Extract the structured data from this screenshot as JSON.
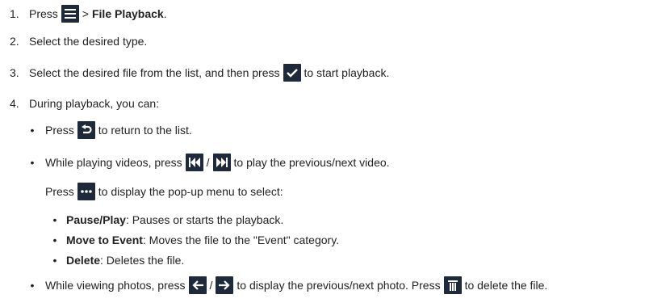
{
  "steps": {
    "s1": {
      "num": "1.",
      "pre": "Press",
      "gt": ">",
      "bold": "File Playback",
      "post": "."
    },
    "s2": {
      "num": "2.",
      "text": "Select the desired type."
    },
    "s3": {
      "num": "3.",
      "pre": "Select the desired file from the list, and then press",
      "post": "to start playback."
    },
    "s4": {
      "num": "4.",
      "text": "During playback, you can:"
    }
  },
  "bullets": {
    "b1": {
      "pre": "Press",
      "post": "to return to the list."
    },
    "b2": {
      "pre": "While playing videos, press",
      "sep": "/",
      "post": "to play the previous/next video."
    },
    "popup": {
      "pre": "Press",
      "post": "to display the pop-up menu to select:"
    },
    "sub": [
      {
        "bold": "Pause/Play",
        "text": ": Pauses or starts the playback."
      },
      {
        "bold": "Move to Event",
        "text": ": Moves the file to the \"Event\" category."
      },
      {
        "bold": "Delete",
        "text": ": Deletes the file."
      }
    ],
    "b3": {
      "pre": "While viewing photos, press",
      "sep": "/",
      "mid": "to display the previous/next photo. Press",
      "post": "to delete the file."
    }
  },
  "bullet_char": "•",
  "colors": {
    "icon_bg": "#1e2a3a",
    "icon_fg": "#ffffff",
    "text": "#222222"
  },
  "icons": [
    "menu-icon",
    "checkmark-icon",
    "return-icon",
    "skip-previous-icon",
    "skip-next-icon",
    "more-icon",
    "arrow-left-icon",
    "arrow-right-icon",
    "trash-icon"
  ]
}
